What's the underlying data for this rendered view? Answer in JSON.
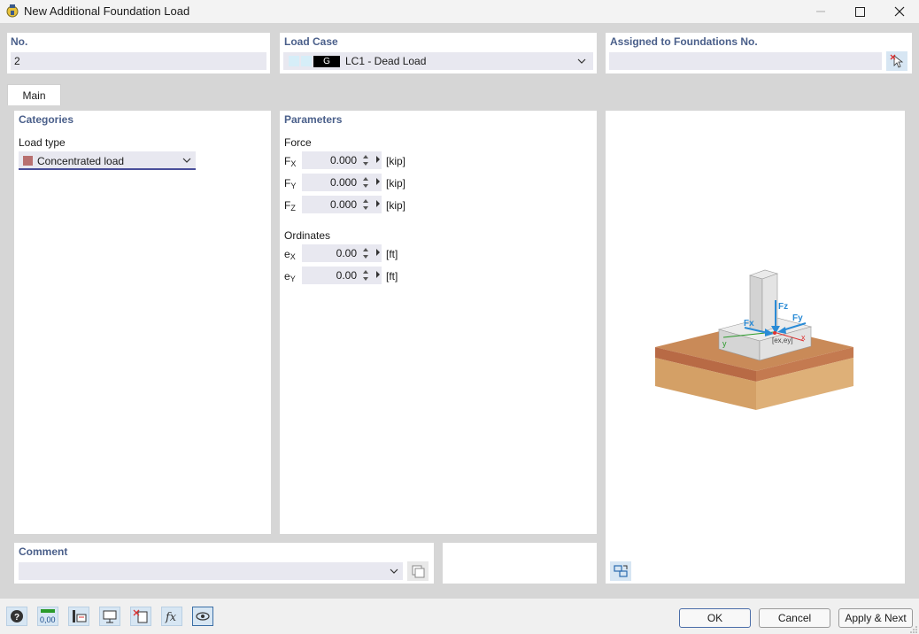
{
  "window": {
    "title": "New Additional Foundation Load"
  },
  "header": {
    "no_label": "No.",
    "no_value": "2",
    "loadcase_label": "Load Case",
    "loadcase_badge": "G",
    "loadcase_value": "LC1 - Dead Load",
    "assigned_label": "Assigned to Foundations No.",
    "assigned_value": ""
  },
  "tabs": [
    {
      "label": "Main"
    }
  ],
  "categories": {
    "title": "Categories",
    "load_type_label": "Load type",
    "load_type_value": "Concentrated load",
    "load_type_color": "#b87070"
  },
  "parameters": {
    "title": "Parameters",
    "force_label": "Force",
    "forces": [
      {
        "symbol": "F",
        "sub": "X",
        "value": "0.000",
        "unit": "[kip]"
      },
      {
        "symbol": "F",
        "sub": "Y",
        "value": "0.000",
        "unit": "[kip]"
      },
      {
        "symbol": "F",
        "sub": "Z",
        "value": "0.000",
        "unit": "[kip]"
      }
    ],
    "ordinates_label": "Ordinates",
    "ordinates": [
      {
        "symbol": "e",
        "sub": "X",
        "value": "0.00",
        "unit": "[ft]"
      },
      {
        "symbol": "e",
        "sub": "Y",
        "value": "0.00",
        "unit": "[ft]"
      }
    ]
  },
  "diagram": {
    "fz": "Fz",
    "fy": "Fy",
    "fx": "Fx",
    "x": "x",
    "y": "y",
    "exey": "[ex,ey]"
  },
  "comment": {
    "label": "Comment",
    "value": ""
  },
  "footer": {
    "ok": "OK",
    "cancel": "Cancel",
    "apply_next": "Apply & Next",
    "tools": [
      "help-icon",
      "units-icon",
      "member-info-icon",
      "display-icon",
      "delete-selection-icon",
      "function-icon",
      "view-icon"
    ]
  },
  "colors": {
    "accent_label": "#4a5f8a",
    "field_bg": "#e8e8f0",
    "soil_top": "#c98a58",
    "soil_side": "#d4a066",
    "force_arrow": "#2a8bd6"
  }
}
